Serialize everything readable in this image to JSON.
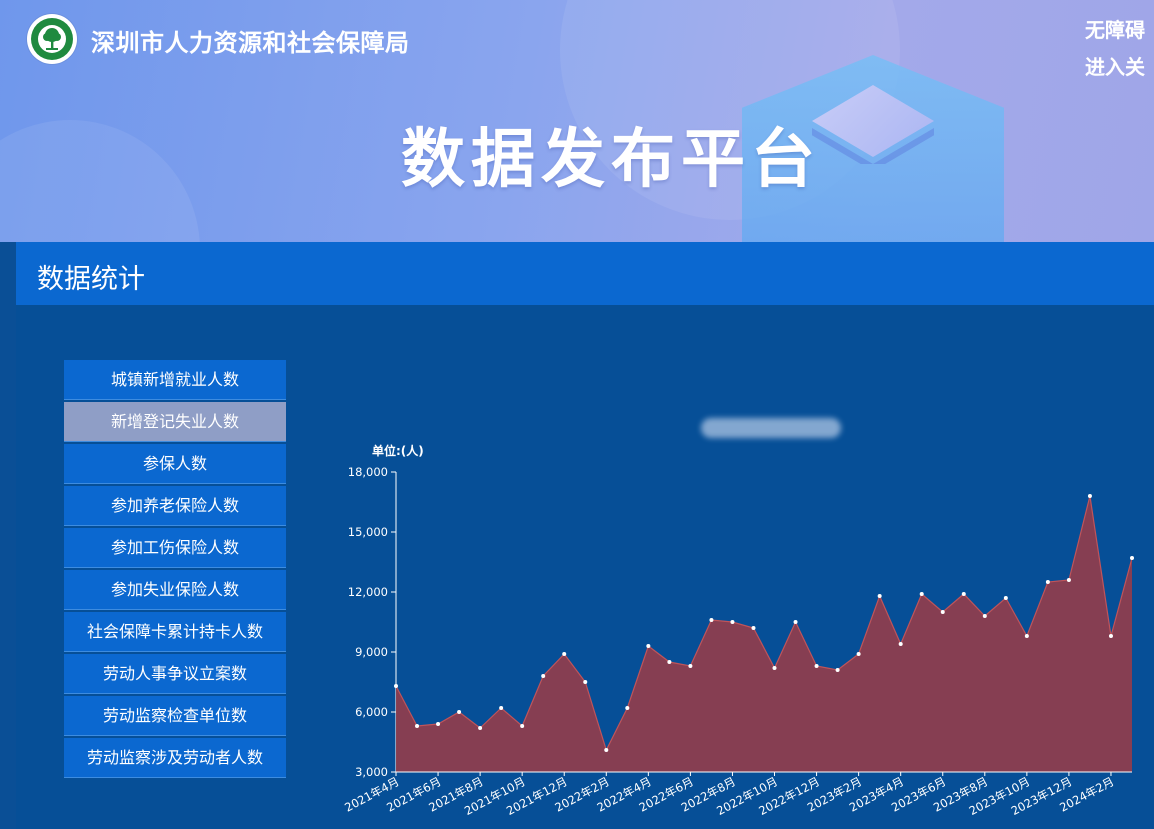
{
  "header": {
    "org_name": "深圳市人力资源和社会保障局",
    "accessibility_link": "无障碍",
    "care_mode_link": "进入关",
    "platform_title": "数据发布平台"
  },
  "section": {
    "title": "数据统计"
  },
  "side_menu": {
    "items": [
      {
        "label": "城镇新增就业人数",
        "active": false
      },
      {
        "label": "新增登记失业人数",
        "active": true
      },
      {
        "label": "参保人数",
        "active": false
      },
      {
        "label": "参加养老保险人数",
        "active": false
      },
      {
        "label": "参加工伤保险人数",
        "active": false
      },
      {
        "label": "参加失业保险人数",
        "active": false
      },
      {
        "label": "社会保障卡累计持卡人数",
        "active": false
      },
      {
        "label": "劳动人事争议立案数",
        "active": false
      },
      {
        "label": "劳动监察检查单位数",
        "active": false
      },
      {
        "label": "劳动监察涉及劳动者人数",
        "active": false
      }
    ]
  },
  "colors": {
    "area_fill": "#8b3d4f",
    "area_line": "#c0545a",
    "point": "#ffffff",
    "axis": "#ffffff",
    "active_menu": "#8f9ec6",
    "menu": "#0b68d0"
  },
  "chart_data": {
    "type": "area",
    "unit_label": "单位:(人)",
    "ylim": [
      3000,
      18000
    ],
    "y_ticks": [
      "3,000",
      "6,000",
      "9,000",
      "12,000",
      "15,000",
      "18,000"
    ],
    "x_tick_labels": [
      "2021年4月",
      "2021年6月",
      "2021年8月",
      "2021年10月",
      "2021年12月",
      "2022年2月",
      "2022年4月",
      "2022年6月",
      "2022年8月",
      "2022年10月",
      "2022年12月",
      "2023年2月",
      "2023年4月",
      "2023年6月",
      "2023年8月",
      "2023年10月",
      "2023年12月",
      "2024年2月"
    ],
    "x": [
      "2021年4月",
      "2021年5月",
      "2021年6月",
      "2021年7月",
      "2021年8月",
      "2021年9月",
      "2021年10月",
      "2021年11月",
      "2021年12月",
      "2022年1月",
      "2022年2月",
      "2022年3月",
      "2022年4月",
      "2022年5月",
      "2022年6月",
      "2022年7月",
      "2022年8月",
      "2022年9月",
      "2022年10月",
      "2022年11月",
      "2022年12月",
      "2023年1月",
      "2023年2月",
      "2023年3月",
      "2023年4月",
      "2023年5月",
      "2023年6月",
      "2023年7月",
      "2023年8月",
      "2023年9月",
      "2023年10月",
      "2023年11月",
      "2023年12月",
      "2024年1月",
      "2024年2月",
      "2024年3月"
    ],
    "values": [
      7300,
      5300,
      5400,
      6000,
      5200,
      6200,
      5300,
      7800,
      8900,
      7500,
      4100,
      6200,
      9300,
      8500,
      8300,
      10600,
      10500,
      10200,
      8200,
      10500,
      8300,
      8100,
      8900,
      11800,
      9400,
      11900,
      11000,
      11900,
      10800,
      11700,
      9800,
      12500,
      12600,
      16800,
      9800,
      13700
    ]
  }
}
